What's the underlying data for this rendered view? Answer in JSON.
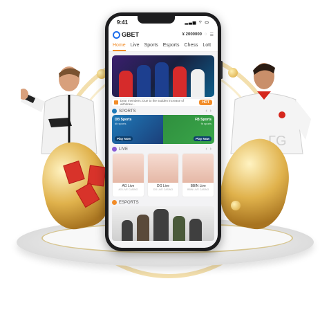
{
  "phone": {
    "status_time": "9:41",
    "status_icons": "▂▃▅ ⌔ ▭"
  },
  "appbar": {
    "brand": "GBET",
    "balance": "¥ 2000000"
  },
  "tabs": [
    {
      "label": "Home"
    },
    {
      "label": "Live"
    },
    {
      "label": "Sports"
    },
    {
      "label": "Esports"
    },
    {
      "label": "Chess"
    },
    {
      "label": "Lott"
    }
  ],
  "ticker": {
    "text": "Dear members: Due to the sudden increase of withdraw...",
    "hot_label": "HOT"
  },
  "sections": {
    "sports": "SPORTS",
    "live": "LIVE",
    "esports": "ESPORTS"
  },
  "sports_cards": [
    {
      "name": "DB Sports",
      "sub": "db sports",
      "play": "Play Now"
    },
    {
      "name": "FB Sports",
      "sub": "fb sports",
      "play": "Play Now"
    }
  ],
  "live_cards": [
    {
      "name": "AG Live",
      "sub": "AG LIVE CASINO"
    },
    {
      "name": "DG Live",
      "sub": "DG LIVE CASINO"
    },
    {
      "name": "BBIN Live",
      "sub": "BBIN LIVE CASINO"
    }
  ],
  "colors": {
    "accent": "#f28c28",
    "brand_blue": "#1f6feb",
    "sports_left": "#1f7ab8",
    "sports_right": "#3aa64a",
    "gold": "#e0b24c"
  }
}
